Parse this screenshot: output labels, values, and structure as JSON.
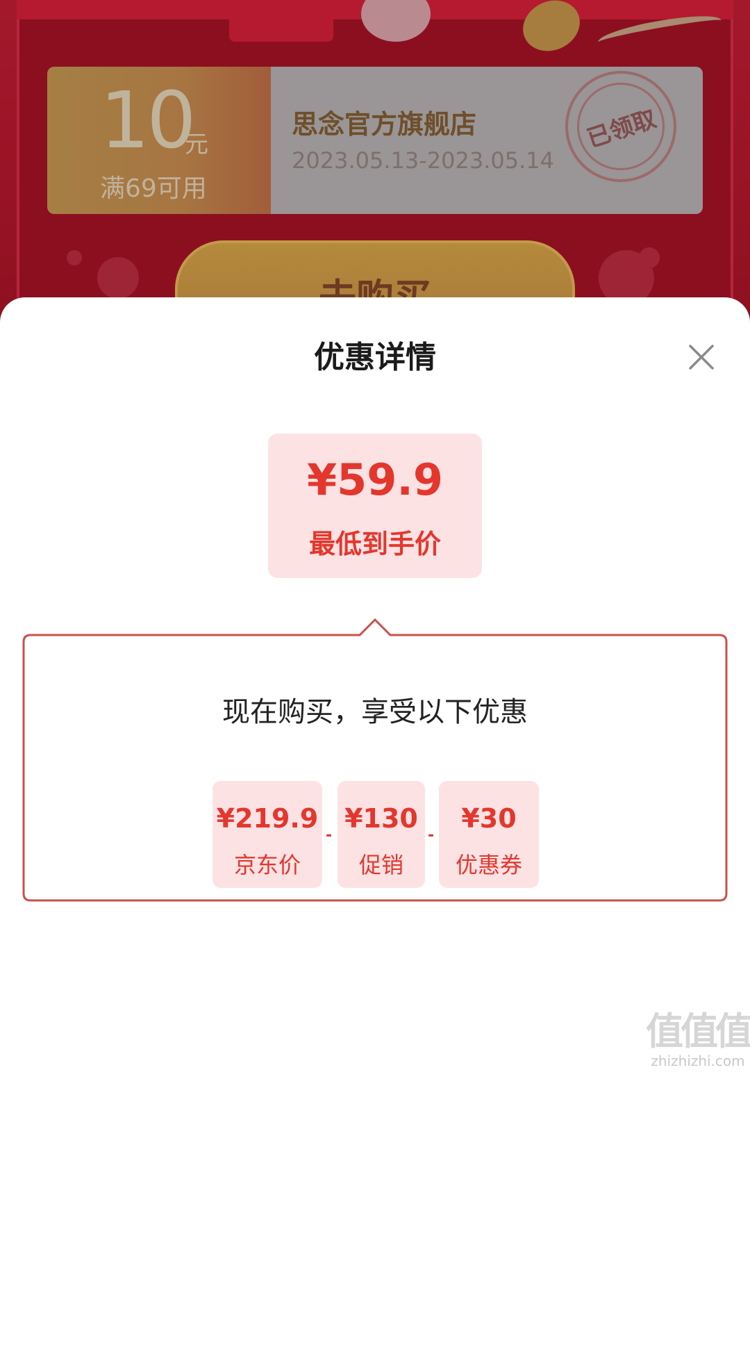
{
  "background": {
    "coupon": {
      "amount": "10",
      "unit": "元",
      "condition": "满69可用",
      "shop_name": "思念官方旗舰店",
      "valid_dates": "2023.05.13-2023.05.14",
      "stamp_text": "已领取"
    },
    "buy_button_label": "去购买"
  },
  "sheet": {
    "title": "优惠详情",
    "close_icon": "close-icon",
    "final_price": {
      "value": "¥59.9",
      "label": "最低到手价"
    },
    "benefits": {
      "heading": "现在购买，享受以下优惠",
      "items": [
        {
          "value": "¥219.9",
          "label": "京东价"
        },
        {
          "value": "¥130",
          "label": "促销"
        },
        {
          "value": "¥30",
          "label": "优惠券"
        }
      ],
      "operator": "-"
    }
  },
  "watermark": {
    "glyphs": "值值值",
    "url": "zhizhizhi.com"
  },
  "colors": {
    "accent": "#e3372d",
    "chip_bg": "#fde2e4",
    "frame": "#c9514a",
    "overlay_red": "#8e1020"
  }
}
